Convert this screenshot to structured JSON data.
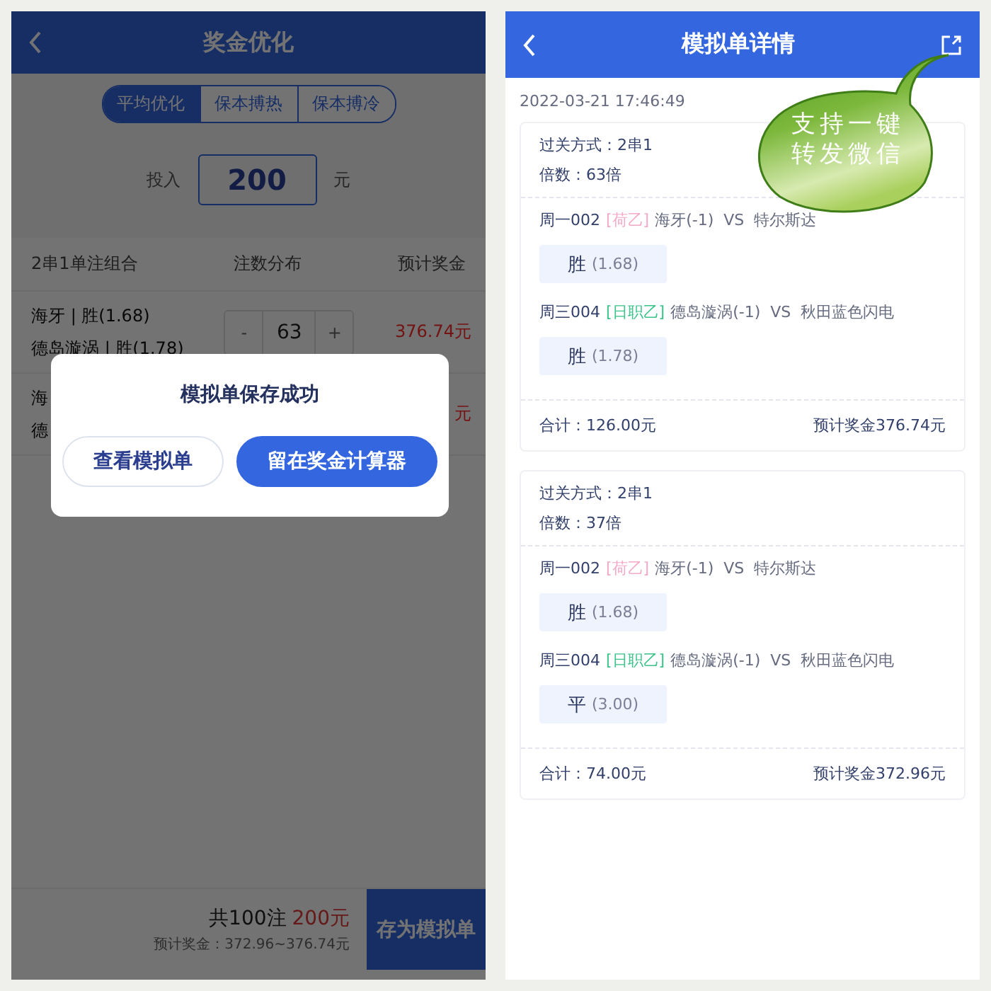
{
  "left": {
    "title": "奖金优化",
    "tabs": [
      {
        "label": "平均优化",
        "selected": true
      },
      {
        "label": "保本搏热",
        "selected": false
      },
      {
        "label": "保本搏冷",
        "selected": false
      }
    ],
    "stake": {
      "label": "投入",
      "value": "200",
      "unit": "元"
    },
    "table": {
      "columns": [
        "2串1单注组合",
        "注数分布",
        "预计奖金"
      ],
      "rows": [
        {
          "lines": [
            "海牙 | 胜(1.68)",
            "德岛漩涡 | 胜(1.78)"
          ],
          "stepper": {
            "minus": "-",
            "count": "63",
            "plus": "+"
          },
          "prize": "376.74元"
        },
        {
          "lines": [
            "海",
            "德"
          ],
          "prize": "元"
        }
      ]
    },
    "footer": {
      "count": "共100注",
      "amount": "200元",
      "estimate": "预计奖金：372.96~376.74元",
      "button": "存为模拟单"
    },
    "dialog": {
      "title": "模拟单保存成功",
      "buttons": [
        {
          "label": "查看模拟单",
          "kind": "secondary"
        },
        {
          "label": "留在奖金计算器",
          "kind": "primary"
        }
      ]
    }
  },
  "right": {
    "title": "模拟单详情",
    "callout": [
      "支持一键",
      "转发微信"
    ],
    "timestamp": "2022-03-21 17:46:49",
    "slips": [
      {
        "pass_type": "过关方式：2串1",
        "multiple": "倍数：63倍",
        "matches": [
          {
            "code": "周一002",
            "league": "[荷乙]",
            "color": "#f4a9c9",
            "teams": "海牙(-1)  VS  特尔斯达",
            "pick": "胜",
            "odds": "(1.68)"
          },
          {
            "code": "周三004",
            "league": "[日职乙]",
            "color": "#3cc48a",
            "teams": "德岛漩涡(-1)  VS  秋田蓝色闪电",
            "pick": "胜",
            "odds": "(1.78)"
          }
        ],
        "total": "合计：126.00元",
        "prize": "预计奖金376.74元"
      },
      {
        "pass_type": "过关方式：2串1",
        "multiple": "倍数：37倍",
        "matches": [
          {
            "code": "周一002",
            "league": "[荷乙]",
            "color": "#f4a9c9",
            "teams": "海牙(-1)  VS  特尔斯达",
            "pick": "胜",
            "odds": "(1.68)"
          },
          {
            "code": "周三004",
            "league": "[日职乙]",
            "color": "#3cc48a",
            "teams": "德岛漩涡(-1)  VS  秋田蓝色闪电",
            "pick": "平",
            "odds": "(3.00)"
          }
        ],
        "total": "合计：74.00元",
        "prize": "预计奖金372.96元"
      }
    ]
  }
}
